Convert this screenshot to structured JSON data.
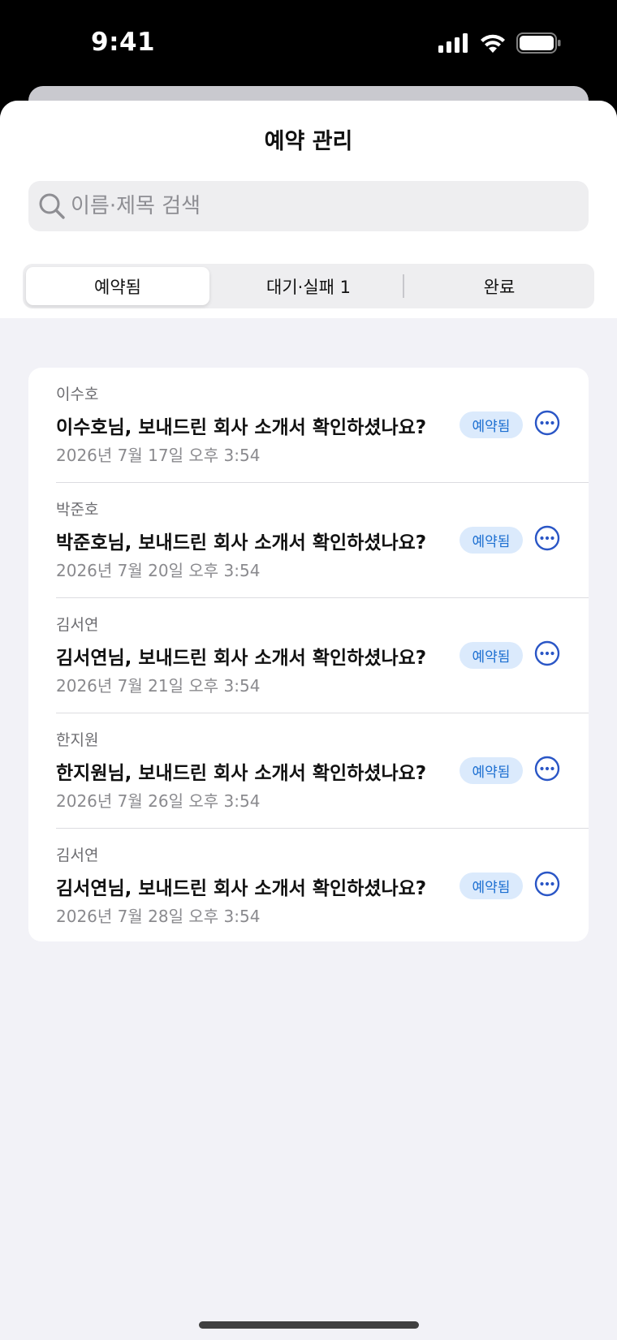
{
  "status_bar": {
    "time": "9:41"
  },
  "header": {
    "title": "예약 관리"
  },
  "search": {
    "placeholder": "이름·제목 검색",
    "value": ""
  },
  "tabs": [
    {
      "label": "예약됨",
      "selected": true
    },
    {
      "label": "대기·실패 1",
      "selected": false
    },
    {
      "label": "완료",
      "selected": false
    }
  ],
  "items": [
    {
      "sender": "이수호",
      "title": "이수호님, 보내드린 회사 소개서 확인하셨나요?",
      "date": "2026년 7월 17일 오후 3:54",
      "badge": "예약됨"
    },
    {
      "sender": "박준호",
      "title": "박준호님, 보내드린 회사 소개서 확인하셨나요?",
      "date": "2026년 7월 20일 오후 3:54",
      "badge": "예약됨"
    },
    {
      "sender": "김서연",
      "title": "김서연님, 보내드린 회사 소개서 확인하셨나요?",
      "date": "2026년 7월 21일 오후 3:54",
      "badge": "예약됨"
    },
    {
      "sender": "한지원",
      "title": "한지원님, 보내드린 회사 소개서 확인하셨나요?",
      "date": "2026년 7월 26일 오후 3:54",
      "badge": "예약됨"
    },
    {
      "sender": "김서연",
      "title": "김서연님, 보내드린 회사 소개서 확인하셨나요?",
      "date": "2026년 7월 28일 오후 3:54",
      "badge": "예약됨"
    }
  ],
  "colors": {
    "accent": "#2a56c6",
    "badge_bg": "#dbeafc",
    "badge_text": "#1c6fd1",
    "sheet_bg": "#f2f2f7"
  },
  "icons": {
    "search": "search-icon",
    "more": "ellipsis-circle-icon"
  }
}
